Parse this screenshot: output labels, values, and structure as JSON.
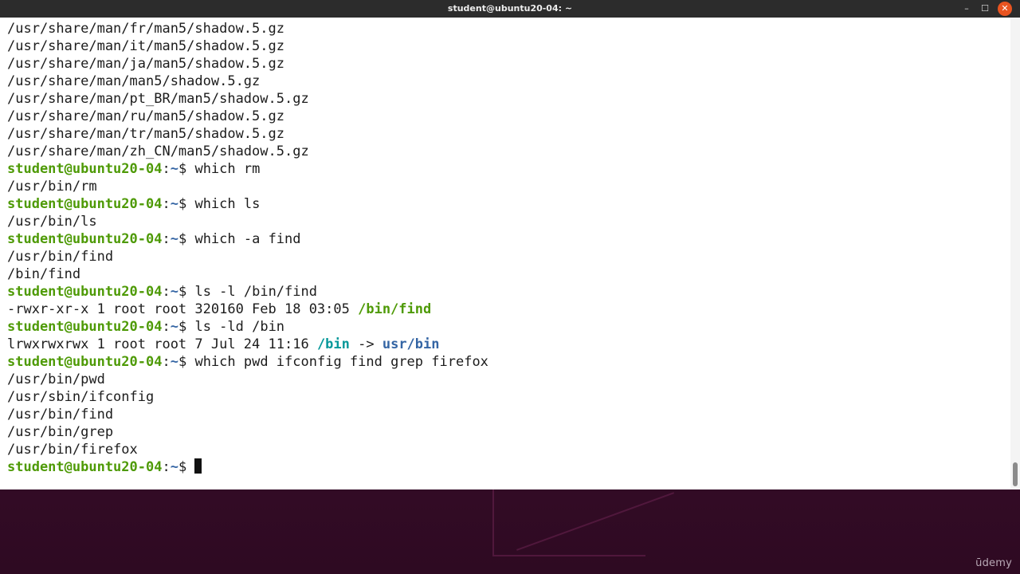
{
  "window": {
    "title": "student@ubuntu20-04: ~",
    "minimize_glyph": "–",
    "maximize_glyph": "☐",
    "close_glyph": "✕"
  },
  "prompt": {
    "user": "student@ubuntu20-04",
    "sep": ":",
    "path": "~",
    "symbol": "$ "
  },
  "terminal": {
    "lines": [
      {
        "type": "out",
        "text": "/usr/share/man/fr/man5/shadow.5.gz"
      },
      {
        "type": "out",
        "text": "/usr/share/man/it/man5/shadow.5.gz"
      },
      {
        "type": "out",
        "text": "/usr/share/man/ja/man5/shadow.5.gz"
      },
      {
        "type": "out",
        "text": "/usr/share/man/man5/shadow.5.gz"
      },
      {
        "type": "out",
        "text": "/usr/share/man/pt_BR/man5/shadow.5.gz"
      },
      {
        "type": "out",
        "text": "/usr/share/man/ru/man5/shadow.5.gz"
      },
      {
        "type": "out",
        "text": "/usr/share/man/tr/man5/shadow.5.gz"
      },
      {
        "type": "out",
        "text": "/usr/share/man/zh_CN/man5/shadow.5.gz"
      },
      {
        "type": "cmd",
        "text": "which rm"
      },
      {
        "type": "out",
        "text": "/usr/bin/rm"
      },
      {
        "type": "cmd",
        "text": "which ls"
      },
      {
        "type": "out",
        "text": "/usr/bin/ls"
      },
      {
        "type": "cmd",
        "text": "which -a find"
      },
      {
        "type": "out",
        "text": "/usr/bin/find"
      },
      {
        "type": "out",
        "text": "/bin/find"
      },
      {
        "type": "cmd",
        "text": "ls -l /bin/find"
      },
      {
        "type": "lsfile",
        "prefix": "-rwxr-xr-x 1 root root 320160 Feb 18 03:05 ",
        "name": "/bin/find"
      },
      {
        "type": "cmd",
        "text": "ls -ld /bin"
      },
      {
        "type": "lslink",
        "prefix": "lrwxrwxrwx 1 root root 7 Jul 24 11:16 ",
        "name": "/bin",
        "arrow": " -> ",
        "target": "usr/bin"
      },
      {
        "type": "cmd",
        "text": "which pwd ifconfig find grep firefox"
      },
      {
        "type": "out",
        "text": "/usr/bin/pwd"
      },
      {
        "type": "out",
        "text": "/usr/sbin/ifconfig"
      },
      {
        "type": "out",
        "text": "/usr/bin/find"
      },
      {
        "type": "out",
        "text": "/usr/bin/grep"
      },
      {
        "type": "out",
        "text": "/usr/bin/firefox"
      },
      {
        "type": "prompt"
      }
    ]
  },
  "watermark": "ūdemy",
  "colors": {
    "prompt_user": "#4e9a06",
    "prompt_path": "#3465a4",
    "executable": "#4e9a06",
    "symlink": "#06989a",
    "directory": "#3465a4",
    "close_button": "#e95420"
  }
}
